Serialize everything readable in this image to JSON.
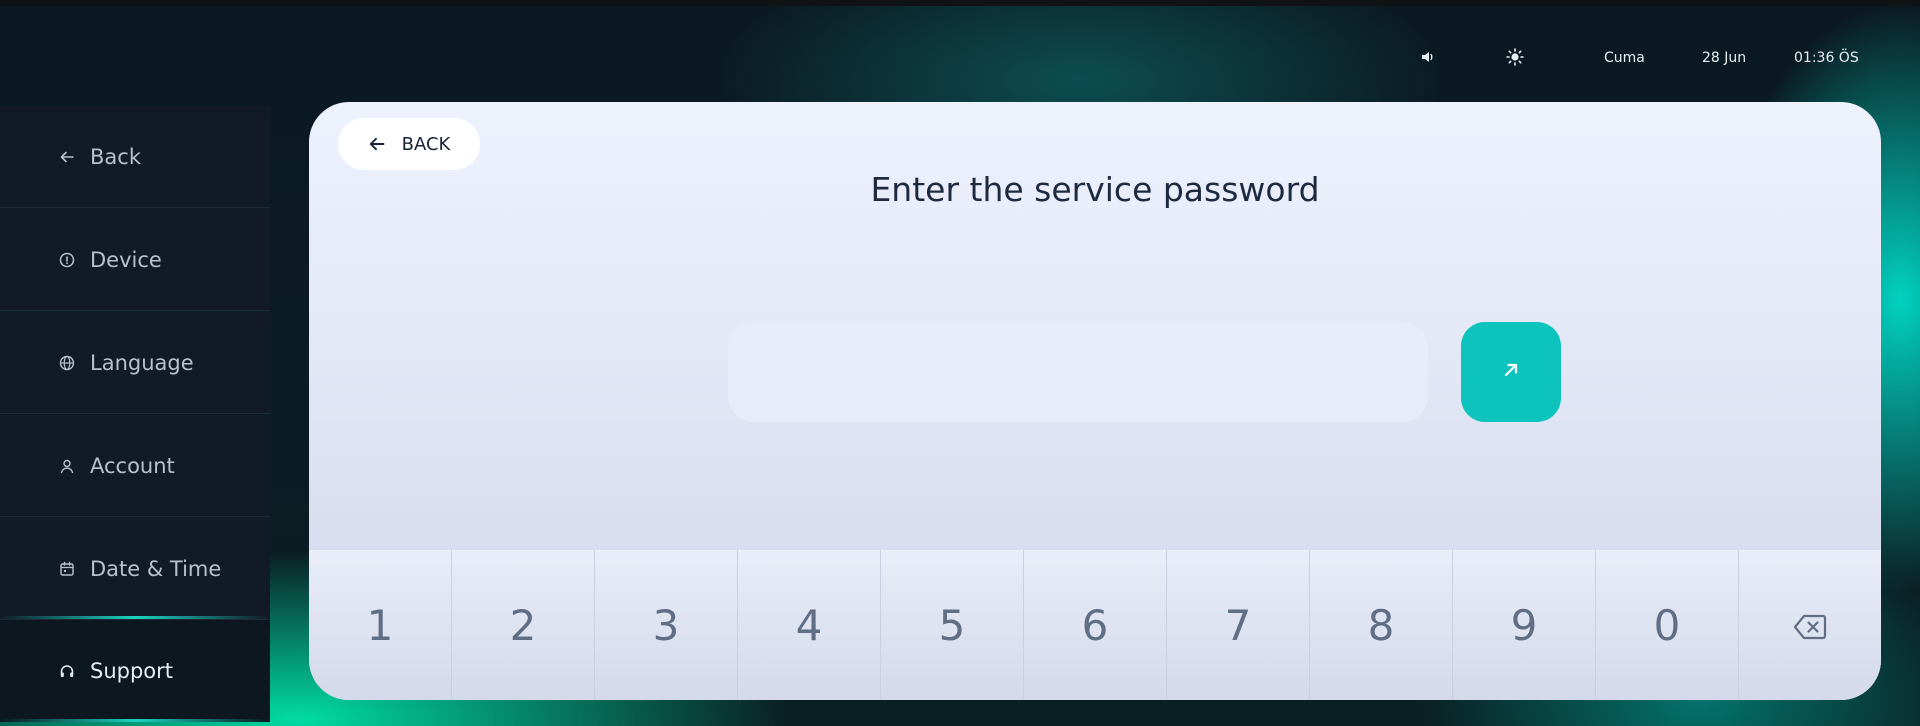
{
  "status_bar": {
    "volume_icon": "speaker-icon",
    "brightness_icon": "sun-icon",
    "day": "Cuma",
    "date": "28 Jun",
    "time": "01:36 ÖS"
  },
  "sidebar": {
    "items": [
      {
        "label": "Back",
        "icon": "arrow-left-icon"
      },
      {
        "label": "Device",
        "icon": "info-icon"
      },
      {
        "label": "Language",
        "icon": "globe-icon"
      },
      {
        "label": "Account",
        "icon": "user-icon"
      },
      {
        "label": "Date & Time",
        "icon": "calendar-icon"
      },
      {
        "label": "Support",
        "icon": "headphones-icon",
        "active": true
      }
    ]
  },
  "main": {
    "back_label": "BACK",
    "title": "Enter the service password",
    "password_value": "",
    "submit_icon": "arrow-up-right-icon"
  },
  "keypad": {
    "keys": [
      "1",
      "2",
      "3",
      "4",
      "5",
      "6",
      "7",
      "8",
      "9",
      "0"
    ],
    "backspace_icon": "backspace-icon"
  },
  "colors": {
    "accent": "#0cc4bd",
    "sidebar_bg": "#111a26",
    "panel_bg": "#eef2fd",
    "text_dark": "#1e2a40"
  }
}
